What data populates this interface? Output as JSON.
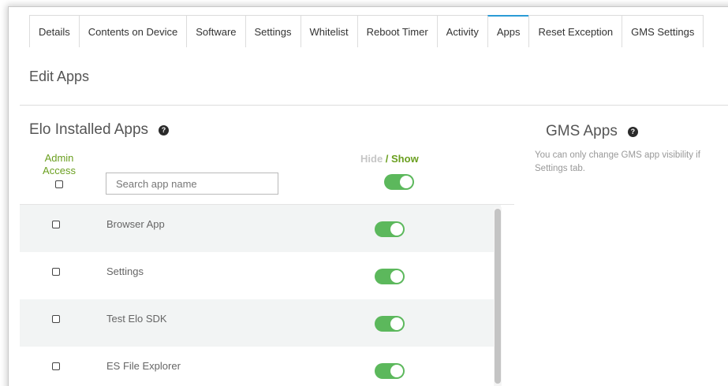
{
  "tabs": [
    {
      "label": "Details"
    },
    {
      "label": "Contents on Device"
    },
    {
      "label": "Software"
    },
    {
      "label": "Settings"
    },
    {
      "label": "Whitelist"
    },
    {
      "label": "Reboot Timer"
    },
    {
      "label": "Activity"
    },
    {
      "label": "Apps",
      "active": true
    },
    {
      "label": "Reset Exception"
    },
    {
      "label": "GMS Settings"
    }
  ],
  "page_title": "Edit Apps",
  "elo_section": {
    "title": "Elo Installed Apps",
    "help_icon": "question-circle-icon",
    "admin_access_label_1": "Admin",
    "admin_access_label_2": "Access",
    "search_placeholder": "Search app name",
    "hide_label": "Hide",
    "slash": " / ",
    "show_label": "Show",
    "apps": [
      {
        "name": "Browser App",
        "admin_access": false,
        "visible": true
      },
      {
        "name": "Settings",
        "admin_access": false,
        "visible": true
      },
      {
        "name": "Test Elo SDK",
        "admin_access": false,
        "visible": true
      },
      {
        "name": "ES File Explorer",
        "admin_access": false,
        "visible": true
      }
    ]
  },
  "gms_section": {
    "title": "GMS Apps",
    "help_icon": "question-circle-icon",
    "description_line_1": "You can only change GMS app visibility if",
    "description_line_2": "Settings tab."
  },
  "colors": {
    "accent_green": "#6a9f1f",
    "toggle_on": "#5cb85c",
    "active_tab_border": "#2b9bd6"
  }
}
